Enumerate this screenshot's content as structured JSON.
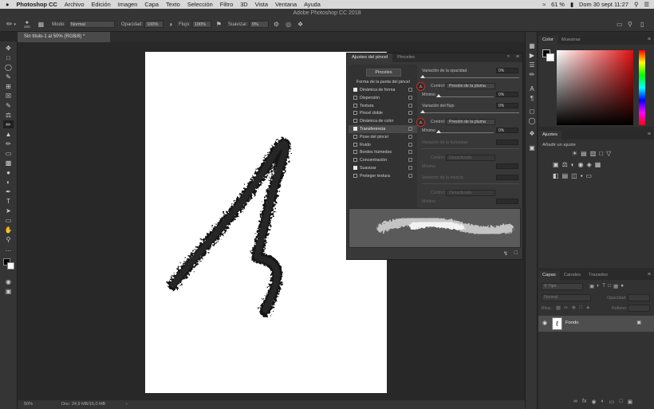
{
  "menubar": {
    "apple": "",
    "items": [
      "Photoshop CC",
      "Archivo",
      "Edición",
      "Imagen",
      "Capa",
      "Texto",
      "Selección",
      "Filtro",
      "3D",
      "Vista",
      "Ventana",
      "Ayuda"
    ],
    "battery": "61 %",
    "datetime": "Dom 30 sept  11:27"
  },
  "window_title": "Adobe Photoshop CC 2018",
  "options": {
    "brush_size": "200",
    "mode_label": "Modo:",
    "mode_value": "Normal",
    "opacity_label": "Opacidad:",
    "opacity_value": "100%",
    "flow_label": "Flujo:",
    "flow_value": "100%",
    "smooth_label": "Suavizar:",
    "smooth_value": "0%"
  },
  "document_tab": "Sin título-1 al 50% (RGB/8) *",
  "status": {
    "zoom": "50%",
    "doc": "Doc: 24,9 MB/15,0 MB"
  },
  "brush_panel": {
    "tabs": [
      "Ajustes del pincel",
      "Pinceles"
    ],
    "pinceles_button": "Pinceles",
    "tip_shape": "Forma de la punta del pincel",
    "options": [
      {
        "label": "Dinámica de forma",
        "checked": true,
        "selected": false
      },
      {
        "label": "Dispersión",
        "checked": false,
        "selected": false
      },
      {
        "label": "Textura",
        "checked": false,
        "selected": false
      },
      {
        "label": "Pincel doble",
        "checked": false,
        "selected": false
      },
      {
        "label": "Dinámica de color",
        "checked": false,
        "selected": false
      },
      {
        "label": "Transferencia",
        "checked": true,
        "selected": true
      },
      {
        "label": "Pose del pincel",
        "checked": false,
        "selected": false
      },
      {
        "label": "Ruido",
        "checked": false,
        "selected": false
      },
      {
        "label": "Bordes húmedos",
        "checked": false,
        "selected": false
      },
      {
        "label": "Concentración",
        "checked": false,
        "selected": false
      },
      {
        "label": "Suavizar",
        "checked": true,
        "selected": false
      },
      {
        "label": "Proteger textura",
        "checked": false,
        "selected": false
      }
    ],
    "opacity_jitter_label": "Variación de la opacidad",
    "opacity_jitter_value": "0%",
    "control_label": "Control:",
    "control1_value": "Presión de la pluma",
    "minimum_label": "Mínimo",
    "minimum1_value": "0%",
    "flow_jitter_label": "Variación del flujo",
    "flow_jitter_value": "0%",
    "control2_value": "Presión de la pluma",
    "minimum2_value": "0%",
    "wet_jitter_label": "Variación de la humedad",
    "control3_value": "Desactivado",
    "mix_jitter_label": "Variación de la mezcla",
    "control4_value": "Desactivado"
  },
  "color_panel": {
    "tabs": [
      "Color",
      "Muestras"
    ]
  },
  "adjust_panel": {
    "tab": "Ajustes",
    "add_label": "Añadir un ajuste"
  },
  "layers_panel": {
    "tabs": [
      "Capas",
      "Canales",
      "Trazados"
    ],
    "filter_placeholder": "Tipo",
    "blend_mode": "Normal",
    "opacity_label": "Opacidad:",
    "lock_label": "Bloq.:",
    "fill_label": "Relleno:",
    "layer_name": "Fondo"
  }
}
